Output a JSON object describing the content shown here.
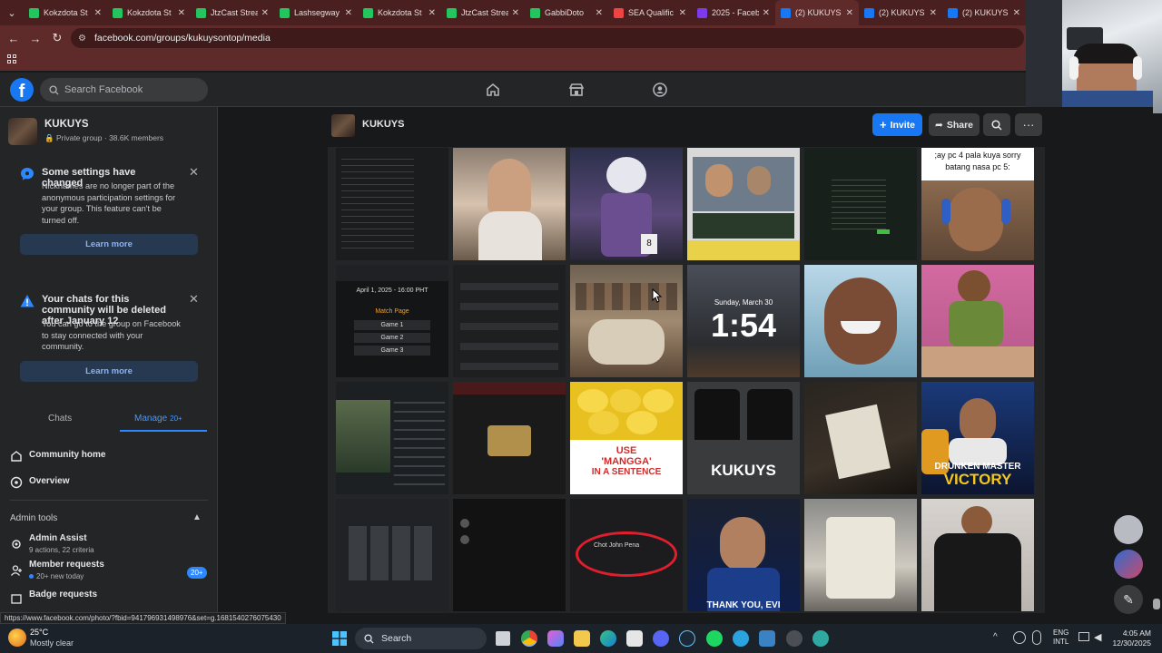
{
  "browser": {
    "tabs": [
      {
        "title": "Kokzdota St",
        "color": "#22c55e",
        "active": false
      },
      {
        "title": "Kokzdota St",
        "color": "#22c55e",
        "active": false
      },
      {
        "title": "JtzCast Strea",
        "color": "#22c55e",
        "active": false
      },
      {
        "title": "Lashsegway",
        "color": "#22c55e",
        "active": false
      },
      {
        "title": "Kokzdota St",
        "color": "#22c55e",
        "active": false
      },
      {
        "title": "JtzCast Strea",
        "color": "#22c55e",
        "active": false
      },
      {
        "title": "GabbiDoto",
        "color": "#22c55e",
        "active": false
      },
      {
        "title": "SEA Qualific",
        "color": "#ef4444",
        "active": false
      },
      {
        "title": "2025 - Faceb",
        "color": "#7c3aed",
        "active": false
      },
      {
        "title": "(2) KUKUYS",
        "color": "#1877f2",
        "active": true
      },
      {
        "title": "(2) KUKUYS",
        "color": "#1877f2",
        "active": false
      },
      {
        "title": "(2) KUKUYS",
        "color": "#1877f2",
        "active": false
      }
    ],
    "url": "facebook.com/groups/kukuysontop/media",
    "status_url": "https://www.facebook.com/photo/?fbid=941796931498976&set=g.1681540276075430"
  },
  "fb": {
    "search_placeholder": "Search Facebook"
  },
  "sidebar": {
    "group_name": "KUKUYS",
    "group_meta": "Private group · 38.6K members",
    "notice1": {
      "title": "Some settings have changed",
      "body": "Nicknames are no longer part of the anonymous participation settings for your group. This feature can't be turned off.",
      "button": "Learn more"
    },
    "notice2": {
      "title": "Your chats for this community will be deleted after January 12",
      "body": "You can go to the group on Facebook to stay connected with your community.",
      "button": "Learn more"
    },
    "tabs": {
      "chats": "Chats",
      "manage": "Manage",
      "manage_count": "20+"
    },
    "community_home": "Community home",
    "overview": "Overview",
    "admin_tools": "Admin tools",
    "admin_assist": {
      "label": "Admin Assist",
      "sub": "9 actions, 22 criteria"
    },
    "member_requests": {
      "label": "Member requests",
      "sub": "20+ new today",
      "badge": "20+"
    },
    "badge_requests": {
      "label": "Badge requests"
    }
  },
  "main": {
    "group_name": "KUKUYS",
    "invite": "Invite",
    "share": "Share"
  },
  "photo_captions": {
    "r0c5": ";ay pc 4 pala kuya sorry\nbatang nasa pc 5:",
    "r1c0_header": "April 1, 2025 - 16:00 PHT",
    "r1c0_match": "Match Page",
    "r1c0_games": [
      "Game 1",
      "Game 2",
      "Game 3"
    ],
    "r1c3_date": "Sunday, March 30",
    "r1c3_time": "1:54",
    "r2c2_line1": "USE",
    "r2c2_line2": "'MANGGA'",
    "r2c2_line3": "IN A SENTENCE",
    "r2c3_brand": "KUKUYS",
    "r2c5_line1": "DRUNKEN MASTER",
    "r2c5_line2": "VICTORY",
    "r3c2_name": "Chot John Pena",
    "r3c3_caption": "THANK YOU, EVI"
  },
  "taskbar": {
    "temp": "25°C",
    "weather": "Mostly clear",
    "search": "Search",
    "lang1": "ENG",
    "lang2": "INTL",
    "time": "4:05 AM",
    "date": "12/30/2025"
  }
}
